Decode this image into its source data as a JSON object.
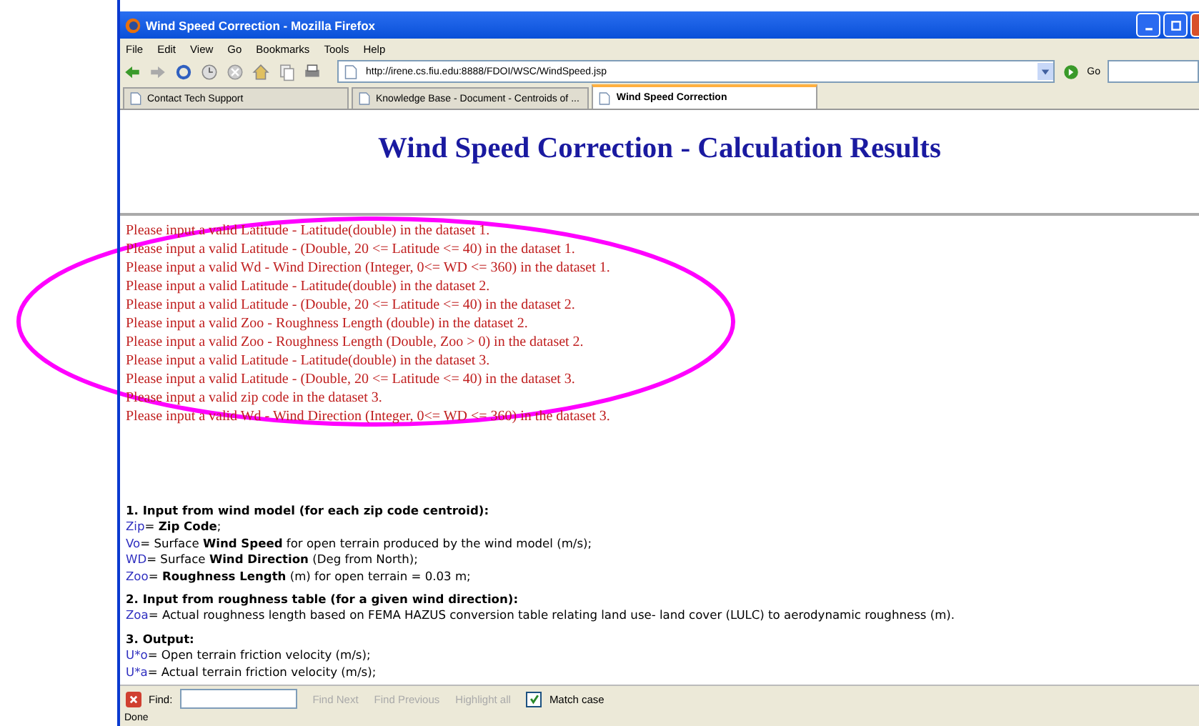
{
  "window": {
    "title": "Wind Speed Correction - Mozilla Firefox"
  },
  "menu": [
    "File",
    "Edit",
    "View",
    "Go",
    "Bookmarks",
    "Tools",
    "Help"
  ],
  "address": {
    "value": "http://irene.cs.fiu.edu:8888/FDOI/WSC/WindSpeed.jsp",
    "go": "Go"
  },
  "tabs": [
    {
      "label": "Contact Tech Support",
      "selected": false
    },
    {
      "label": "Knowledge Base - Document - Centroids of ...",
      "selected": false
    },
    {
      "label": "Wind Speed Correction",
      "selected": true
    }
  ],
  "page": {
    "heading": "Wind Speed Correction - Calculation Results",
    "errors": [
      "Please input a valid Latitude - Latitude(double) in the dataset 1.",
      "Please input a valid Latitude - (Double, 20 <= Latitude <= 40) in the dataset 1.",
      "Please input a valid Wd - Wind Direction (Integer, 0<= WD <= 360) in the dataset 1.",
      "Please input a valid Latitude - Latitude(double) in the dataset 2.",
      "Please input a valid Latitude - (Double, 20 <= Latitude <= 40) in the dataset 2.",
      "Please input a valid Zoo - Roughness Length (double) in the dataset 2.",
      "Please input a valid Zoo - Roughness Length (Double, Zoo > 0) in the dataset 2.",
      "Please input a valid Latitude - Latitude(double) in the dataset 3.",
      "Please input a valid Latitude - (Double, 20 <= Latitude <= 40) in the dataset 3.",
      "Please input a valid zip code in the dataset 3.",
      "Please input a valid Wd - Wind Direction (Integer, 0<= WD <= 360) in the dataset 3."
    ],
    "sections": [
      {
        "title": "1. Input from wind model (for each zip code centroid):",
        "items": [
          {
            "var": "Zip",
            "text": "= **Zip Code**;"
          },
          {
            "var": "Vo",
            "text": "= Surface **Wind Speed** for open terrain produced by the wind model (m/s);"
          },
          {
            "var": "WD",
            "text": "= Surface **Wind Direction** (Deg from North);"
          },
          {
            "var": "Zoo",
            "text": "= **Roughness Length** (m) for open terrain = 0.03 m;"
          }
        ]
      },
      {
        "title": "2. Input from roughness table (for a given wind direction):",
        "items": [
          {
            "var": "Zoa",
            "text": "= Actual roughness length based on FEMA HAZUS conversion table relating land use- land cover (LULC) to aerodynamic roughness (m)."
          }
        ]
      },
      {
        "title": "3. Output:",
        "items": [
          {
            "var": "U*o",
            "text": "= Open terrain friction velocity (m/s);"
          },
          {
            "var": "U*a",
            "text": "= Actual terrain friction velocity (m/s);"
          }
        ]
      }
    ]
  },
  "find_bar": {
    "label": "Find:",
    "buttons": [
      "Find Next",
      "Find Previous",
      "Highlight all"
    ],
    "match_case": {
      "label": "Match case",
      "checked": true
    }
  },
  "status_bar": "Done"
}
